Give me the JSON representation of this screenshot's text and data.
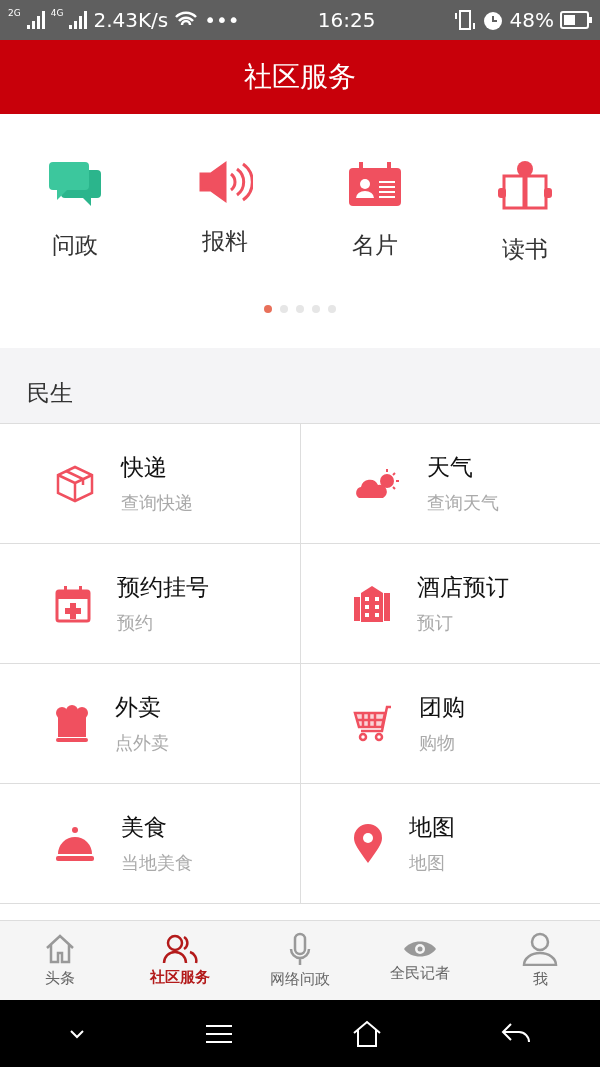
{
  "status_bar": {
    "signal_1": "2G",
    "signal_2": "4G",
    "speed": "2.43K/s",
    "more": "•••",
    "time": "16:25",
    "battery": "48%"
  },
  "header": {
    "title": "社区服务"
  },
  "shortcuts": [
    {
      "kind": "chat",
      "label": "问政"
    },
    {
      "kind": "speaker",
      "label": "报料"
    },
    {
      "kind": "card",
      "label": "名片"
    },
    {
      "kind": "book",
      "label": "读书"
    }
  ],
  "pager": [
    {
      "selected": true
    },
    {
      "selected": false
    },
    {
      "selected": false
    },
    {
      "selected": false
    },
    {
      "selected": false
    }
  ],
  "section": {
    "title": "民生"
  },
  "services": [
    {
      "kind": "package",
      "title": "快递",
      "subtitle": "查询快递"
    },
    {
      "kind": "weather",
      "title": "天气",
      "subtitle": "查询天气"
    },
    {
      "kind": "calendar",
      "title": "预约挂号",
      "subtitle": "预约"
    },
    {
      "kind": "hotel",
      "title": "酒店预订",
      "subtitle": "预订"
    },
    {
      "kind": "chef",
      "title": "外卖",
      "subtitle": "点外卖"
    },
    {
      "kind": "cart",
      "title": "团购",
      "subtitle": "购物"
    },
    {
      "kind": "cloche",
      "title": "美食",
      "subtitle": "当地美食"
    },
    {
      "kind": "pin",
      "title": "地图",
      "subtitle": "地图"
    }
  ],
  "tabs": [
    {
      "kind": "home",
      "label": "头条",
      "selected": false
    },
    {
      "kind": "people",
      "label": "社区服务",
      "selected": true
    },
    {
      "kind": "mic",
      "label": "网络问政",
      "selected": false
    },
    {
      "kind": "eye",
      "label": "全民记者",
      "selected": false
    },
    {
      "kind": "user",
      "label": "我",
      "selected": false
    }
  ]
}
